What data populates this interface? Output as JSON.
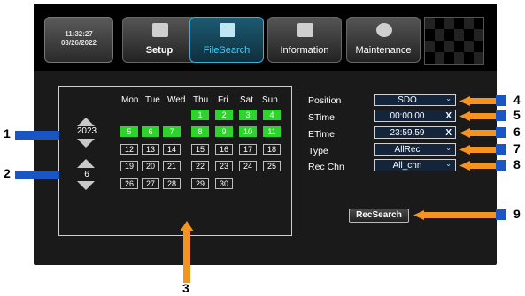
{
  "header": {
    "time": "11:32:27",
    "date": "03/26/2022",
    "tabs": [
      {
        "label": "Setup"
      },
      {
        "label": "FileSearch"
      },
      {
        "label": "Information"
      },
      {
        "label": "Maintenance"
      }
    ]
  },
  "calendar": {
    "year": "2023",
    "month": "6",
    "weekdays": [
      "Mon",
      "Tue",
      "Wed",
      "Thu",
      "Fri",
      "Sat",
      "Sun"
    ],
    "days": [
      "1",
      "2",
      "3",
      "4",
      "5",
      "6",
      "7",
      "8",
      "9",
      "10",
      "11",
      "12",
      "13",
      "14",
      "15",
      "16",
      "17",
      "18",
      "19",
      "20",
      "21",
      "22",
      "23",
      "24",
      "25",
      "26",
      "27",
      "28",
      "29",
      "30"
    ],
    "recorded_days": [
      "1",
      "2",
      "3",
      "4",
      "5",
      "6",
      "7",
      "8",
      "9",
      "10",
      "11"
    ]
  },
  "form": {
    "position": {
      "label": "Position",
      "value": "SDO"
    },
    "stime": {
      "label": "STime",
      "value": "00:00.00"
    },
    "etime": {
      "label": "ETime",
      "value": "23:59.59"
    },
    "type": {
      "label": "Type",
      "value": "AllRec"
    },
    "rec_chn": {
      "label": "Rec Chn",
      "value": "All_chn"
    },
    "clear_glyph": "X",
    "dropdown_glyph": "⌄"
  },
  "recsearch_label": "RecSearch",
  "callouts": [
    "1",
    "2",
    "3",
    "4",
    "5",
    "6",
    "7",
    "8",
    "9"
  ],
  "colors": {
    "recorded_day": "#2ed32e",
    "callout_blue": "#1a55c4",
    "callout_orange": "#f59320",
    "active_tab": "#3fd0ff"
  }
}
